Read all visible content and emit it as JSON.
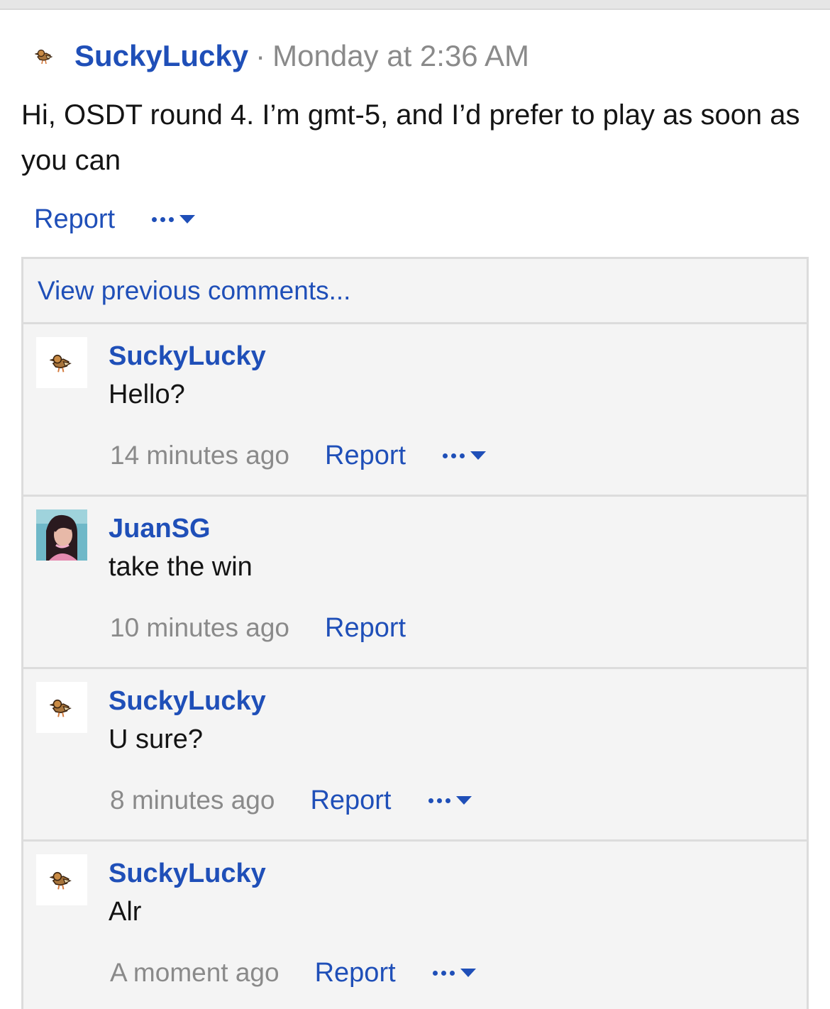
{
  "post": {
    "author": "SuckyLucky",
    "separator": "·",
    "time": "Monday at 2:36 AM",
    "body": "Hi, OSDT round 4. I’m gmt-5, and I’d prefer to play as soon as you can",
    "report_label": "Report",
    "avatar_icon": "pidgey-sprite-icon"
  },
  "comments_section": {
    "view_previous_label": "View previous comments...",
    "comments": [
      {
        "author": "SuckyLucky",
        "text": "Hello?",
        "time": "14 minutes ago",
        "report_label": "Report",
        "has_more_menu": true,
        "avatar_icon": "pidgey-sprite-icon"
      },
      {
        "author": "JuanSG",
        "text": "take the win",
        "time": "10 minutes ago",
        "report_label": "Report",
        "has_more_menu": false,
        "avatar_icon": "profile-photo"
      },
      {
        "author": "SuckyLucky",
        "text": "U sure?",
        "time": "8 minutes ago",
        "report_label": "Report",
        "has_more_menu": true,
        "avatar_icon": "pidgey-sprite-icon"
      },
      {
        "author": "SuckyLucky",
        "text": "Alr",
        "time": "A moment ago",
        "report_label": "Report",
        "has_more_menu": true,
        "avatar_icon": "pidgey-sprite-icon"
      }
    ]
  },
  "colors": {
    "link": "#1f4fb8",
    "muted": "#8a8a8a",
    "text": "#141414",
    "panel_bg": "#f4f4f4",
    "border": "#dcdcdc"
  }
}
